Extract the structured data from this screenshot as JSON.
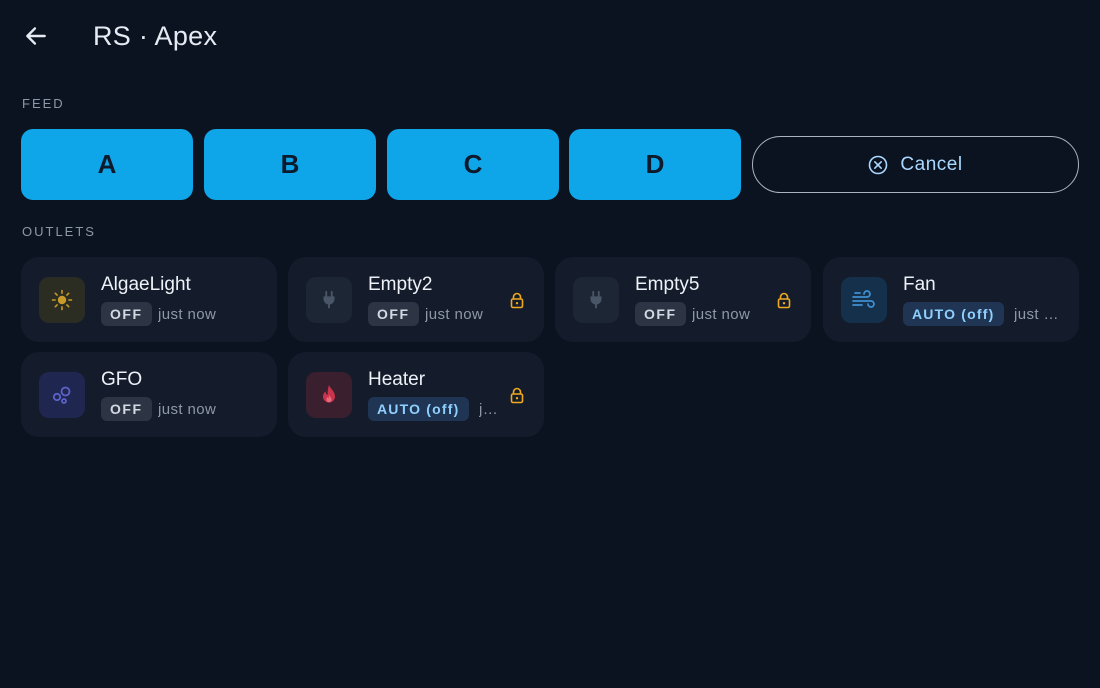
{
  "header": {
    "title": "RS · Apex"
  },
  "feed": {
    "label": "FEED",
    "buttons": [
      "A",
      "B",
      "C",
      "D"
    ],
    "cancel_label": "Cancel"
  },
  "outlets": {
    "label": "OUTLETS",
    "items": [
      {
        "name": "AlgaeLight",
        "state": "OFF",
        "updated": "just now",
        "icon": "sun-icon",
        "locked": false
      },
      {
        "name": "Empty2",
        "state": "OFF",
        "updated": "just now",
        "icon": "plug-icon",
        "locked": true
      },
      {
        "name": "Empty5",
        "state": "OFF",
        "updated": "just now",
        "icon": "plug-icon",
        "locked": true
      },
      {
        "name": "Fan",
        "state": "AUTO (off)",
        "updated": "just now",
        "icon": "wind-icon",
        "locked": false
      },
      {
        "name": "GFO",
        "state": "OFF",
        "updated": "just now",
        "icon": "bubbles-icon",
        "locked": false
      },
      {
        "name": "Heater",
        "state": "AUTO (off)",
        "updated": "just now",
        "icon": "flame-icon",
        "locked": true
      }
    ]
  },
  "colors": {
    "background": "#0c1320",
    "card": "#141c2b",
    "accent": "#0ea5e9",
    "lock": "#f0a91e"
  }
}
